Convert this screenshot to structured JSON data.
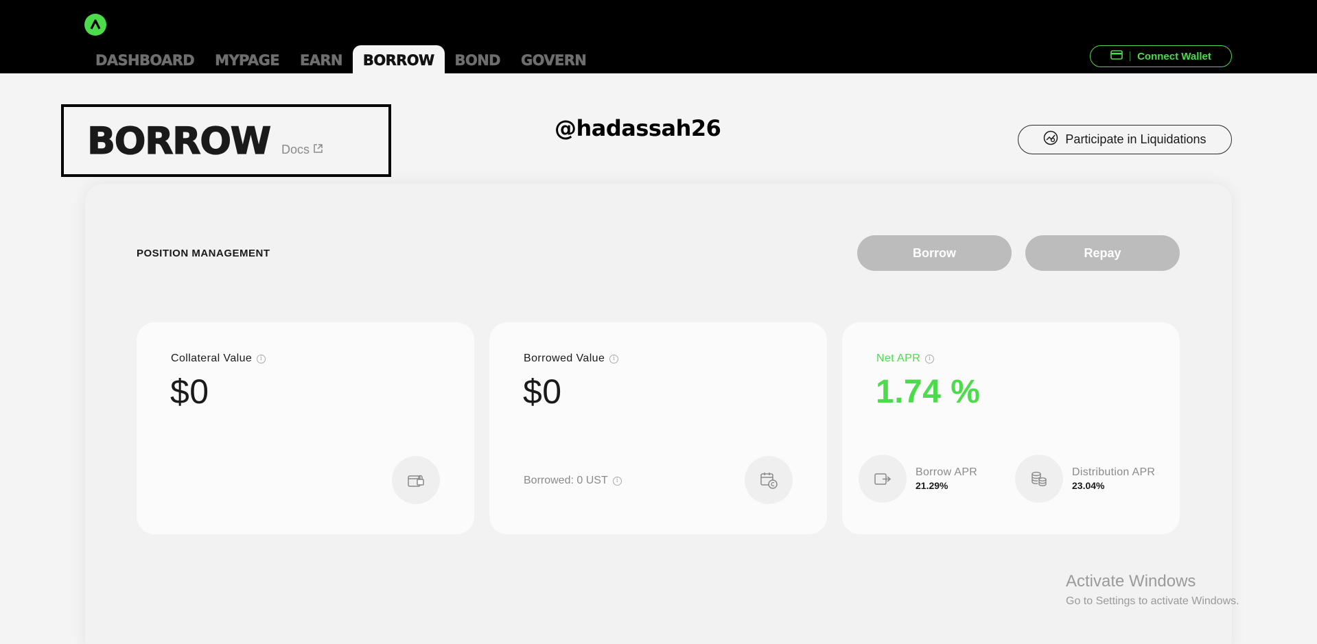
{
  "nav": {
    "items": [
      "DASHBOARD",
      "MYPAGE",
      "EARN",
      "BORROW",
      "BOND",
      "GOVERN"
    ],
    "active": "BORROW",
    "connect_wallet": "Connect Wallet"
  },
  "header": {
    "title": "BORROW",
    "docs": "Docs",
    "handle": "@hadassah26",
    "liquidations": "Participate in Liquidations"
  },
  "position": {
    "section_title": "POSITION MANAGEMENT",
    "borrow_label": "Borrow",
    "repay_label": "Repay"
  },
  "cards": {
    "collateral": {
      "label": "Collateral Value",
      "value": "$0",
      "icon": "wallet-lock-icon"
    },
    "borrowed": {
      "label": "Borrowed Value",
      "value": "$0",
      "sub": "Borrowed: 0 UST",
      "icon": "calendar-coin-icon"
    },
    "net_apr": {
      "label": "Net APR",
      "value": "1.74 %",
      "borrow_apr_label": "Borrow APR",
      "borrow_apr_value": "21.29%",
      "distribution_apr_label": "Distribution APR",
      "distribution_apr_value": "23.04%"
    }
  },
  "watermark": {
    "title": "Activate Windows",
    "subtitle": "Go to Settings to activate Windows."
  },
  "colors": {
    "accent": "#4bdb4b",
    "topbar": "#000000",
    "background": "#f4f4f4",
    "button_disabled": "#bcbcbc"
  }
}
